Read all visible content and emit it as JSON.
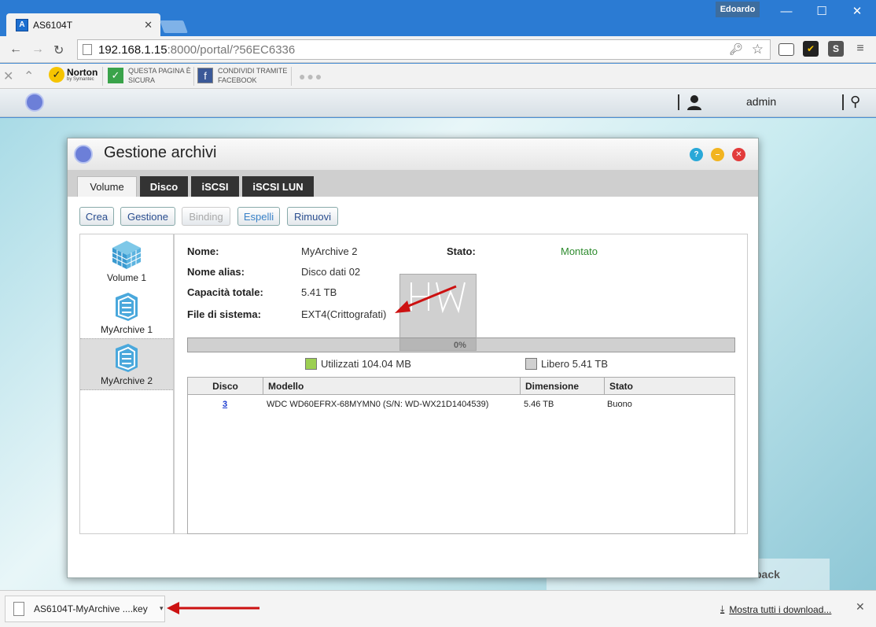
{
  "browser": {
    "tab_title": "AS6104T",
    "user_badge": "Edoardo",
    "url_host": "192.168.1.15",
    "url_rest": ":8000/portal/?56EC6336",
    "bookmarks": {
      "norton_brand": "Norton",
      "norton_sub": "by Symantec",
      "safe_page_line1": "QUESTA PAGINA È",
      "safe_page_line2": "SICURA",
      "facebook_line1": "CONDIVIDI TRAMITE",
      "facebook_line2": "FACEBOOK"
    }
  },
  "appbar": {
    "user": "admin"
  },
  "dialog": {
    "title": "Gestione archivi",
    "tabs": [
      "Volume",
      "Disco",
      "iSCSI",
      "iSCSI LUN"
    ],
    "actions": [
      "Crea",
      "Gestione",
      "Binding",
      "Espelli",
      "Rimuovi"
    ],
    "volumes": [
      "Volume 1",
      "MyArchive 1",
      "MyArchive 2"
    ],
    "details": {
      "name_label": "Nome:",
      "name_value": "MyArchive 2",
      "alias_label": "Nome alias:",
      "alias_value": "Disco dati 02",
      "capacity_label": "Capacità totale:",
      "capacity_value": "5.41 TB",
      "fs_label": "File di sistema:",
      "fs_value": "EXT4(Crittografati)",
      "status_label": "Stato:",
      "status_value": "Montato"
    },
    "usage": {
      "percent_label": "0%",
      "used_fraction": 0.0,
      "used_label": "Utilizzati 104.04 MB",
      "free_label": "Libero 5.41 TB",
      "used_color": "#9ccf52",
      "free_color": "#d0d0d0"
    },
    "disk_table": {
      "headers": [
        "Disco",
        "Modello",
        "Dimensione",
        "Stato"
      ],
      "rows": [
        {
          "disk": "3",
          "model": "WDC WD60EFRX-68MYMN0 (S/N: WD-WX21D1404539)",
          "size": "5.46 TB",
          "status": "Buono"
        }
      ]
    }
  },
  "downloads": {
    "file_name": "AS6104T-MyArchive ....key",
    "show_all": "Mostra tutti i download..."
  },
  "background_tile_text": "back"
}
